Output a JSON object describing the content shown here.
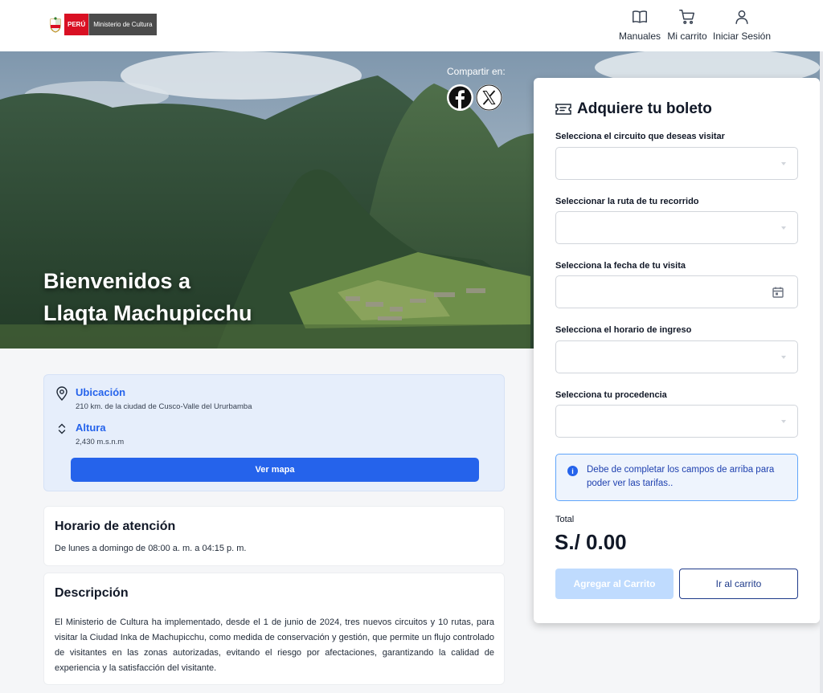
{
  "header": {
    "logo_country": "PERÚ",
    "logo_ministry": "Ministerio de Cultura",
    "nav": [
      {
        "label": "Manuales",
        "icon": "book-icon"
      },
      {
        "label": "Mi carrito",
        "icon": "cart-icon"
      },
      {
        "label": "Iniciar Sesión",
        "icon": "user-icon"
      }
    ]
  },
  "hero": {
    "title_line1": "Bienvenidos a",
    "title_line2": "Llaqta Machupicchu",
    "share_label": "Compartir en:"
  },
  "info": {
    "location_title": "Ubicación",
    "location_text": "210 km. de la ciudad de Cusco-Valle del Ururbamba",
    "altitude_title": "Altura",
    "altitude_text": "2,430 m.s.n.m",
    "map_button": "Ver mapa"
  },
  "schedule": {
    "title": "Horario de atención",
    "text": "De lunes a domingo de 08:00 a. m. a 04:15 p. m."
  },
  "description": {
    "title": "Descripción",
    "text": "El Ministerio de Cultura ha implementado, desde el 1 de junio de 2024, tres nuevos circuitos y 10 rutas, para visitar la Ciudad Inka de Machupicchu, como medida de conservación y gestión, que permite un flujo controlado de visitantes en las zonas autorizadas, evitando el riesgo por afectaciones, garantizando la calidad de experiencia y la satisfacción del visitante."
  },
  "panel": {
    "title": "Adquiere tu boleto",
    "fields": [
      {
        "label": "Selecciona el circuito que deseas visitar",
        "value": ""
      },
      {
        "label": "Seleccionar la ruta de tu recorrido",
        "value": ""
      },
      {
        "label": "Selecciona la fecha de tu visita",
        "value": ""
      },
      {
        "label": "Selecciona el horario de ingreso",
        "value": ""
      },
      {
        "label": "Selecciona tu procedencia",
        "value": ""
      }
    ],
    "notice": "Debe de completar los campos de arriba para poder ver las tarifas..",
    "total_label": "Total",
    "total_value": "S./ 0.00",
    "add_button": "Agregar al Carrito",
    "cart_button": "Ir al carrito"
  },
  "colors": {
    "primary": "#2563eb",
    "primary_disabled": "#bfdbfe",
    "info_bg": "#e6eefb",
    "logo_red": "#d91023"
  }
}
